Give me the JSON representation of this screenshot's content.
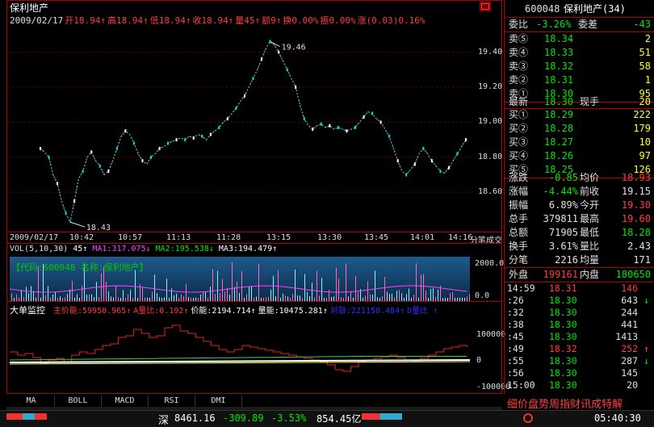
{
  "header": {
    "stock_name": "保利地产",
    "info_line": [
      {
        "t": "2009/02/17",
        "c": "#e0e0e0"
      },
      {
        "t": "开18.94↑",
        "c": "#ff3c3c"
      },
      {
        "t": "高18.94↑",
        "c": "#ff3c3c"
      },
      {
        "t": "低18.94↑",
        "c": "#ff3c3c"
      },
      {
        "t": "收18.94↑",
        "c": "#ff3c3c"
      },
      {
        "t": "量45↑",
        "c": "#ff3c3c"
      },
      {
        "t": "额9↑",
        "c": "#ff3c3c"
      },
      {
        "t": "换0.00%",
        "c": "#ff3c3c"
      },
      {
        "t": "振0.00%",
        "c": "#ff3c3c"
      },
      {
        "t": "涨(0.03)0.16%",
        "c": "#ff3c3c"
      }
    ]
  },
  "price_chart": {
    "price_axis": [
      "19.40",
      "19.20",
      "19.00",
      "18.80",
      "18.60"
    ],
    "high_label": "19.46",
    "low_label": "18.43",
    "time_axis": [
      "2009/02/17",
      "10:42",
      "10:57",
      "11:13",
      "11:28",
      "13:15",
      "13:30",
      "13:45",
      "14:01",
      "14:16"
    ],
    "time_axis_end": "分笔成交"
  },
  "chart_data": {
    "type": "line",
    "title": "",
    "series": [
      {
        "values": [
          18.85,
          18.83,
          18.8,
          18.7,
          18.65,
          18.55,
          18.48,
          18.43,
          18.55,
          18.68,
          18.72,
          18.8,
          18.83,
          18.78,
          18.75,
          18.7,
          18.72,
          18.78,
          18.85,
          18.92,
          18.95,
          18.93,
          18.88,
          18.82,
          18.78,
          18.76,
          18.8,
          18.82,
          18.85,
          18.86,
          18.88,
          18.89,
          18.9,
          18.91,
          18.9,
          18.92,
          18.91,
          18.93,
          18.92,
          18.9,
          18.93,
          18.95,
          18.97,
          19.0,
          19.02,
          19.05,
          19.08,
          19.12,
          19.15,
          19.2,
          19.25,
          19.3,
          19.36,
          19.42,
          19.46,
          19.44,
          19.4,
          19.35,
          19.3,
          19.25,
          19.2,
          19.1,
          19.02,
          18.98,
          18.96,
          18.98,
          18.99,
          18.97,
          18.98,
          18.96,
          18.97,
          18.96,
          18.95,
          18.96,
          18.97,
          19.0,
          19.03,
          19.06,
          19.05,
          19.02,
          19.0,
          18.96,
          18.92,
          18.85,
          18.78,
          18.72,
          18.7,
          18.73,
          18.76,
          18.82,
          18.85,
          18.82,
          18.78,
          18.75,
          18.72,
          18.71,
          18.74,
          18.78,
          18.82,
          18.86,
          18.9
        ]
      }
    ],
    "volume": {
      "label_line": [
        {
          "t": "VOL(5,10,30)",
          "c": "#e0e0e0"
        },
        {
          "t": " 45↑ ",
          "c": "#ffffff"
        },
        {
          "t": "MA1:317.075↓",
          "c": "#ff40ff"
        },
        {
          "t": " MA2:195.538↓",
          "c": "#00e600"
        },
        {
          "t": " MA3:194.479↑",
          "c": "#ffffff"
        }
      ],
      "axis": [
        "2000.0",
        "0.0"
      ],
      "overlay": "【代码:600048 名称:保利地产】"
    },
    "big_order": {
      "title": "大单监控",
      "label_line": [
        {
          "t": "主价能:59950.965↑",
          "c": "#ff3c3c"
        },
        {
          "t": "A量比:0.192↑",
          "c": "#ff3c3c"
        },
        {
          "t": "价能:2194.714↑",
          "c": "#ffffff"
        },
        {
          "t": "量能:10475.281↑",
          "c": "#ffffff"
        },
        {
          "t": "对敲:221150.484↑",
          "c": "#3030ff"
        },
        {
          "t": "D量比 ↑",
          "c": "#3030ff"
        }
      ],
      "axis": [
        "100000",
        "0",
        "-100000"
      ]
    }
  },
  "quote": {
    "code": "600048",
    "name": "保利地产(34)",
    "weibi_label": "委比",
    "weibi": "-3.26%",
    "weicha_label": "委差",
    "weicha": "-43",
    "asks": [
      {
        "l": "卖⑤",
        "p": "18.34",
        "v": "2"
      },
      {
        "l": "卖④",
        "p": "18.33",
        "v": "51"
      },
      {
        "l": "卖③",
        "p": "18.32",
        "v": "58"
      },
      {
        "l": "卖②",
        "p": "18.31",
        "v": "1"
      },
      {
        "l": "卖①",
        "p": "18.30",
        "v": "95"
      }
    ],
    "latest_label": "最新",
    "latest": "18.30",
    "xianshou_label": "现手",
    "xianshou": "20",
    "bids": [
      {
        "l": "买①",
        "p": "18.29",
        "v": "222"
      },
      {
        "l": "买②",
        "p": "18.28",
        "v": "179"
      },
      {
        "l": "买③",
        "p": "18.27",
        "v": "10"
      },
      {
        "l": "买④",
        "p": "18.26",
        "v": "97"
      },
      {
        "l": "买⑤",
        "p": "18.25",
        "v": "126"
      }
    ],
    "stats": [
      {
        "l1": "涨跌",
        "v1": "-0.85",
        "c1": "#00e600",
        "l2": "均价",
        "v2": "18.93",
        "c2": "#ff3c3c"
      },
      {
        "l1": "涨幅",
        "v1": "-4.44%",
        "c1": "#00e600",
        "l2": "前收",
        "v2": "19.15",
        "c2": "#e0e0e0"
      },
      {
        "l1": "振幅",
        "v1": "6.89%",
        "c1": "#e0e0e0",
        "l2": "今开",
        "v2": "19.30",
        "c2": "#ff3c3c"
      },
      {
        "l1": "总手",
        "v1": "379811",
        "c1": "#e0e0e0",
        "l2": "最高",
        "v2": "19.60",
        "c2": "#ff3c3c"
      },
      {
        "l1": "总额",
        "v1": "71905",
        "c1": "#e0e0e0",
        "l2": "最低",
        "v2": "18.28",
        "c2": "#00e600"
      },
      {
        "l1": "换手",
        "v1": "3.61%",
        "c1": "#e0e0e0",
        "l2": "量比",
        "v2": "2.43",
        "c2": "#e0e0e0"
      },
      {
        "l1": "分笔",
        "v1": "2216",
        "c1": "#e0e0e0",
        "l2": "均量",
        "v2": "171",
        "c2": "#e0e0e0"
      }
    ],
    "waipan_label": "外盘",
    "waipan": "199161",
    "neipan_label": "内盘",
    "neipan": "180650"
  },
  "ticks": [
    {
      "t": "14:59",
      "p": "18.31",
      "pc": "#ff3c3c",
      "v": "146",
      "vc": "#ff3c3c",
      "a": ""
    },
    {
      "t": ":26",
      "p": "18.30",
      "pc": "#00e600",
      "v": "643",
      "vc": "#e0e0e0",
      "a": "↓"
    },
    {
      "t": ":32",
      "p": "18.30",
      "pc": "#00e600",
      "v": "244",
      "vc": "#e0e0e0",
      "a": ""
    },
    {
      "t": ":38",
      "p": "18.30",
      "pc": "#00e600",
      "v": "441",
      "vc": "#e0e0e0",
      "a": ""
    },
    {
      "t": ":45",
      "p": "18.30",
      "pc": "#00e600",
      "v": "1413",
      "vc": "#e0e0e0",
      "a": ""
    },
    {
      "t": ":49",
      "p": "18.32",
      "pc": "#ff3c3c",
      "v": "252",
      "vc": "#ff3c3c",
      "a": "↑"
    },
    {
      "t": ":55",
      "p": "18.30",
      "pc": "#00e600",
      "v": "287",
      "vc": "#e0e0e0",
      "a": "↓"
    },
    {
      "t": ":56",
      "p": "18.30",
      "pc": "#00e600",
      "v": "145",
      "vc": "#e0e0e0",
      "a": ""
    },
    {
      "t": "15:00",
      "p": "18.30",
      "pc": "#00e600",
      "v": "20",
      "vc": "#e0e0e0",
      "a": ""
    }
  ],
  "right_tabs": [
    "细",
    "价",
    "盘",
    "势",
    "周",
    "指",
    "财",
    "讯",
    "成",
    "特",
    "解"
  ],
  "bottom_tabs": [
    "MA",
    "BOLL",
    "MACD",
    "RSI",
    "DMI"
  ],
  "status_bar": {
    "market": "深",
    "index": "8461.16",
    "change": "-309.89",
    "pct": "-3.53%",
    "amount": "854.45亿",
    "time": "05:40:30"
  },
  "colors": {
    "up": "#ff3c3c",
    "down": "#00e600",
    "frame": "#aa0000",
    "accent": "#ffff30"
  }
}
